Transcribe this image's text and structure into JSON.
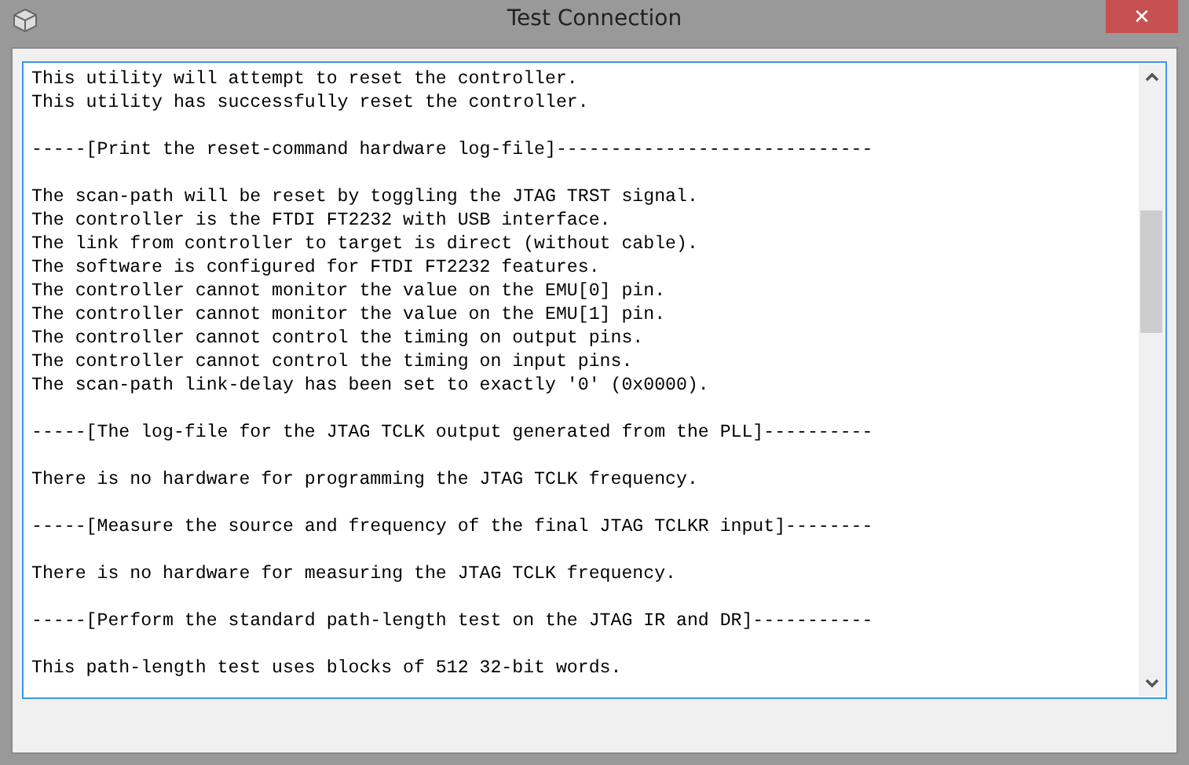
{
  "window": {
    "title": "Test Connection",
    "close": "✕"
  },
  "log": {
    "paragraphs": [
      [
        "This utility will attempt to reset the controller.",
        "This utility has successfully reset the controller."
      ],
      [
        "-----[Print the reset-command hardware log-file]-----------------------------"
      ],
      [
        "The scan-path will be reset by toggling the JTAG TRST signal.",
        "The controller is the FTDI FT2232 with USB interface.",
        "The link from controller to target is direct (without cable).",
        "The software is configured for FTDI FT2232 features.",
        "The controller cannot monitor the value on the EMU[0] pin.",
        "The controller cannot monitor the value on the EMU[1] pin.",
        "The controller cannot control the timing on output pins.",
        "The controller cannot control the timing on input pins.",
        "The scan-path link-delay has been set to exactly '0' (0x0000)."
      ],
      [
        "-----[The log-file for the JTAG TCLK output generated from the PLL]----------"
      ],
      [
        "There is no hardware for programming the JTAG TCLK frequency."
      ],
      [
        "-----[Measure the source and frequency of the final JTAG TCLKR input]--------"
      ],
      [
        "There is no hardware for measuring the JTAG TCLK frequency."
      ],
      [
        "-----[Perform the standard path-length test on the JTAG IR and DR]-----------"
      ],
      [
        "This path-length test uses blocks of 512 32-bit words."
      ]
    ]
  }
}
